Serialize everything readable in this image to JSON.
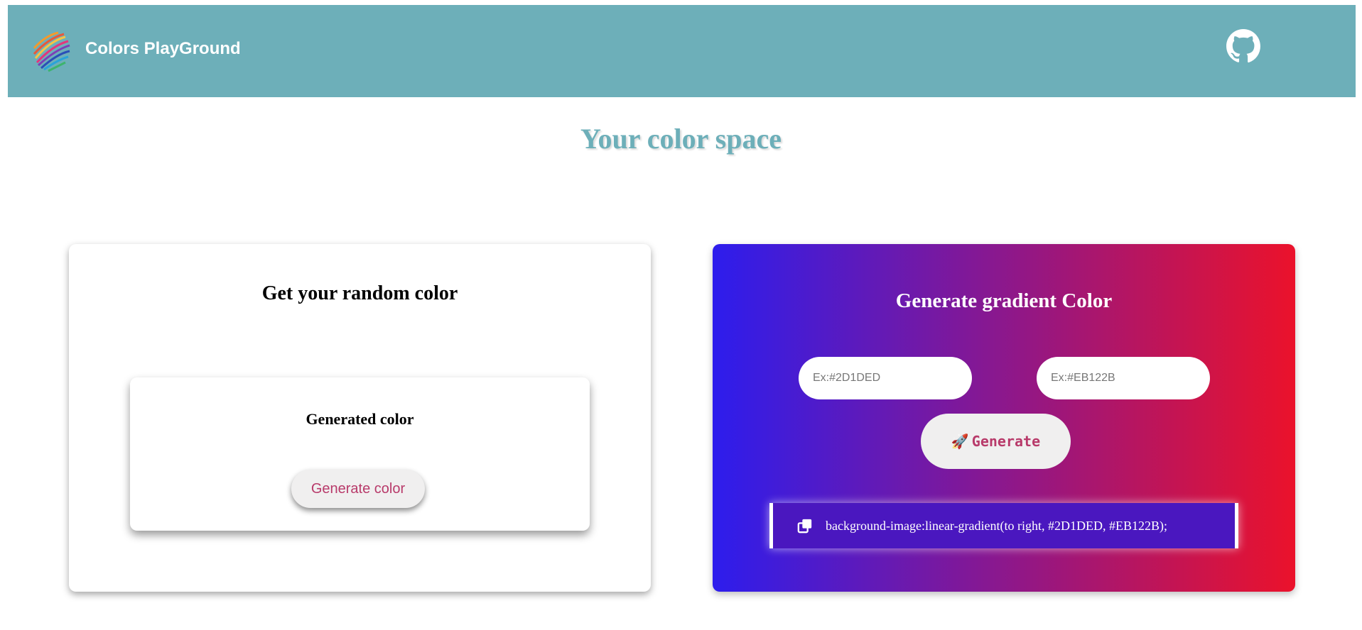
{
  "navbar": {
    "brand": "Colors PlayGround",
    "logo_icon": "rainbow-globe-icon",
    "github_icon": "github-icon"
  },
  "page": {
    "title": "Your color space"
  },
  "random_card": {
    "title": "Get your random color",
    "inner_title": "Generated color",
    "button_label": "Generate color"
  },
  "gradient_card": {
    "title": "Generate gradient Color",
    "input1_placeholder": "Ex:#2D1DED",
    "input2_placeholder": "Ex:#EB122B",
    "button_label": "Generate",
    "button_icon": "rocket-icon",
    "copy_icon": "copy-icon",
    "css_output": "background-image:linear-gradient(to right, #2D1DED, #EB122B);",
    "gradient_colors": [
      "#2D1DED",
      "#EB122B"
    ]
  },
  "colors": {
    "navbar_bg": "#6dafb9",
    "accent_text": "#b83a6a"
  }
}
